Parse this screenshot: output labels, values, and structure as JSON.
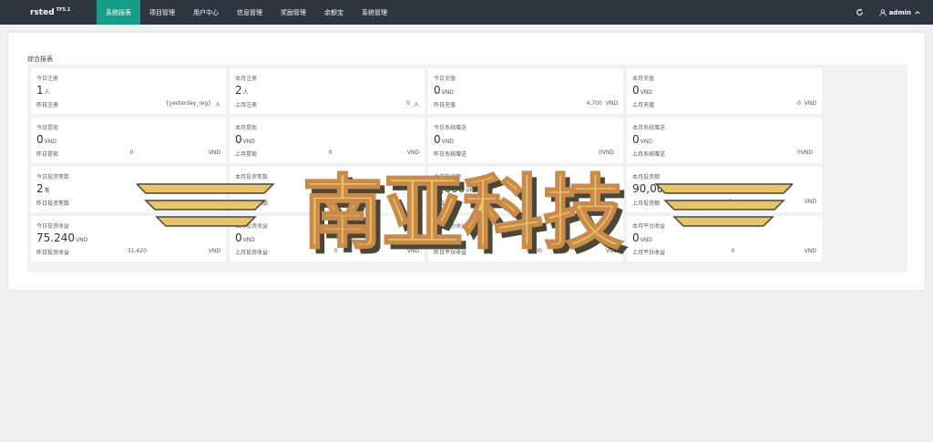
{
  "brand": {
    "name": "rsted",
    "version": "TF5.1"
  },
  "nav": [
    {
      "label": "系统报表",
      "active": true
    },
    {
      "label": "项目管理",
      "active": false
    },
    {
      "label": "用户中心",
      "active": false
    },
    {
      "label": "信息管理",
      "active": false
    },
    {
      "label": "奖励管理",
      "active": false
    },
    {
      "label": "余额宝",
      "active": false
    },
    {
      "label": "系统管理",
      "active": false
    }
  ],
  "header": {
    "user": "admin"
  },
  "panel": {
    "title": "综合报表"
  },
  "cards": [
    {
      "label": "今日注册",
      "value": "1",
      "unit": "人",
      "foot_label": "昨日注册",
      "foot_value": "{yesterday_reg}",
      "foot_unit": "人"
    },
    {
      "label": "本月注册",
      "value": "2",
      "unit": "人",
      "foot_label": "上月注册",
      "foot_value": "0",
      "foot_unit": "人"
    },
    {
      "label": "今日充值",
      "value": "0",
      "unit": "VND",
      "foot_label": "昨日充值",
      "foot_value": "4,700",
      "foot_unit": "VND"
    },
    {
      "label": "本月充值",
      "value": "0",
      "unit": "VND",
      "foot_label": "上月充值",
      "foot_value": "0",
      "foot_unit": "VND"
    },
    {
      "label": "今日提现",
      "value": "0",
      "unit": "VND",
      "foot_label": "昨日提现",
      "foot_value": "0",
      "foot_unit": "VND",
      "center": true
    },
    {
      "label": "本月提现",
      "value": "0",
      "unit": "VND",
      "foot_label": "上月提现",
      "foot_value": "0",
      "foot_unit": "VND",
      "center": true
    },
    {
      "label": "今日系统赠送",
      "value": "0",
      "unit": "VND",
      "foot_label": "昨日系统赠送",
      "foot_value": "0VND",
      "foot_unit": ""
    },
    {
      "label": "本月系统赠送",
      "value": "0",
      "unit": "VND",
      "foot_label": "上月系统赠送",
      "foot_value": "0VND",
      "foot_unit": ""
    },
    {
      "label": "今日投资笔数",
      "value": "2",
      "unit": "笔",
      "foot_label": "昨日投资笔数",
      "foot_value": "",
      "foot_unit": ""
    },
    {
      "label": "本月投资笔数",
      "value": "10",
      "unit": "",
      "foot_label": "上月投资笔数",
      "foot_value": "",
      "foot_unit": ""
    },
    {
      "label": "今日投资额",
      "value": "6,000",
      "unit": "VND",
      "foot_label": "昨日投资额",
      "foot_value": "",
      "foot_unit": ""
    },
    {
      "label": "本月投资额",
      "value": "90,000",
      "unit": "VND",
      "foot_label": "上月投资额",
      "foot_value": "0",
      "foot_unit": "VND",
      "center": true
    },
    {
      "label": "今日投资收益",
      "value": "75.240",
      "unit": "VND",
      "foot_label": "昨日投资收益",
      "foot_value": "31.420",
      "foot_unit": "VND",
      "center": true
    },
    {
      "label": "本月投资收益",
      "value": "0",
      "unit": "VND",
      "foot_label": "上月投资收益",
      "foot_value": "0",
      "foot_unit": "VND",
      "center": true
    },
    {
      "label": "今日平台收益",
      "value": "0",
      "unit": "VND",
      "foot_label": "昨日平台收益",
      "foot_value": "4,700",
      "foot_unit": "VND",
      "center": true
    },
    {
      "label": "本月平台收益",
      "value": "0",
      "unit": "VND",
      "foot_label": "上月平台收益",
      "foot_value": "0",
      "foot_unit": "VND",
      "center": true
    }
  ],
  "watermark": {
    "text": "南亚科技"
  },
  "colors": {
    "topbar": "#2f3441",
    "active": "#169e88",
    "panel_bg": "#f0f1f2",
    "watermark_fill": "#e7c46a",
    "watermark_shadow": "#4a4638"
  }
}
